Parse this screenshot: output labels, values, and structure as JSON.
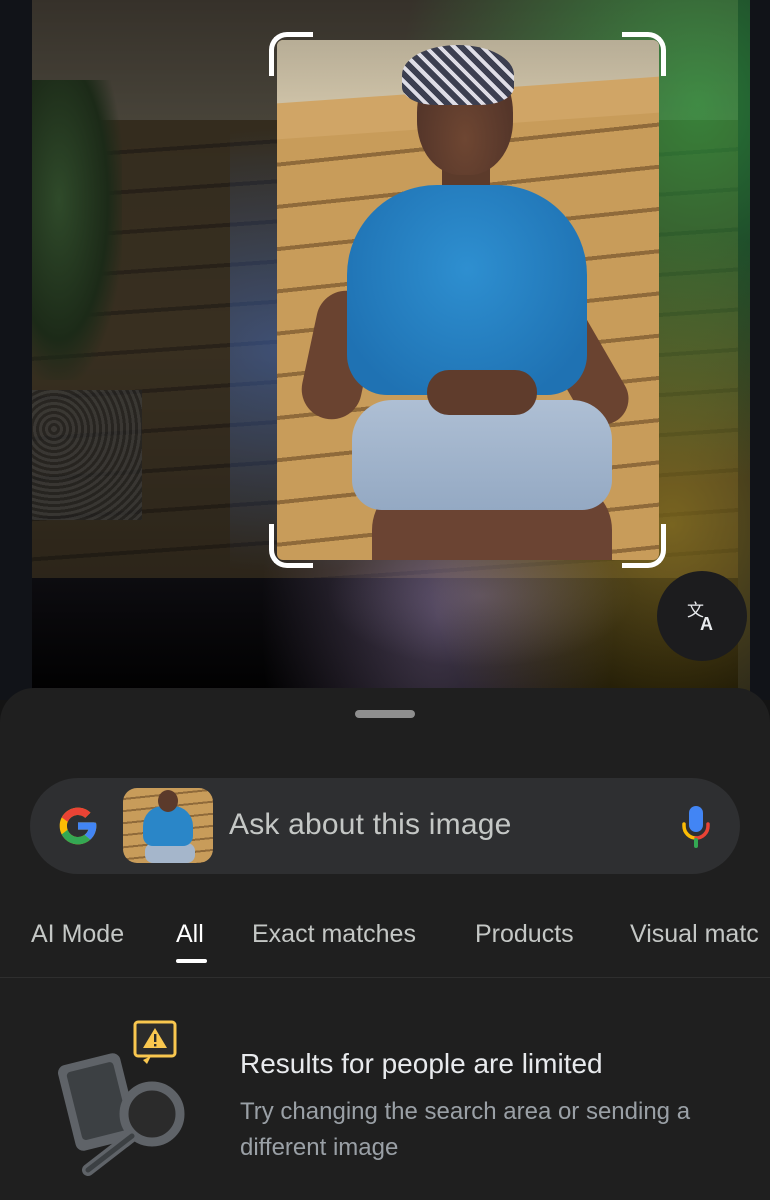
{
  "viewer": {
    "crop_description": "selected image region",
    "translate_button_icon": "translate-icon"
  },
  "search": {
    "logo_icon": "google-g-icon",
    "placeholder": "Ask about this image",
    "mic_icon": "microphone-icon"
  },
  "tabs": [
    {
      "label": "AI Mode"
    },
    {
      "label": "All",
      "active": true
    },
    {
      "label": "Exact matches"
    },
    {
      "label": "Products"
    },
    {
      "label": "Visual matc"
    }
  ],
  "notice": {
    "icon": "warning-magnifier-icon",
    "title": "Results for people are limited",
    "body": "Try changing the search area or sending a different image"
  },
  "colors": {
    "sheet_bg": "#1f1f1f",
    "search_bg": "#2e2f31",
    "google_blue": "#4285F4",
    "google_red": "#EA4335",
    "google_yellow": "#FBBC05",
    "google_green": "#34A853",
    "warning_yellow": "#f9c74f"
  }
}
